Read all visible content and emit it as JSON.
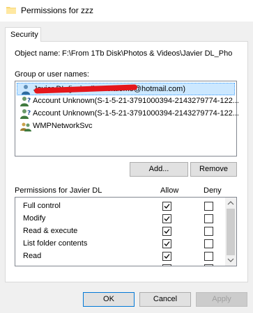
{
  "window": {
    "title": "Permissions for zzz",
    "icon": "folder-icon"
  },
  "tabs": [
    {
      "label": "Security",
      "active": true
    }
  ],
  "object": {
    "label": "Object name:",
    "value": "F:\\From 1Tb Disk\\Photos & Videos\\Javier DL_Pho"
  },
  "groups": {
    "label": "Group or user names:",
    "items": [
      {
        "text": "Javier DL (javierdiazdelalomo@hotmail.com)",
        "icon": "user-icon",
        "selected": true,
        "redacted": true
      },
      {
        "text": "Account Unknown(S-1-5-21-3791000394-2143279774-122...",
        "icon": "unknown-user-icon"
      },
      {
        "text": "Account Unknown(S-1-5-21-3791000394-2143279774-122...",
        "icon": "unknown-user-icon"
      },
      {
        "text": "WMPNetworkSvc",
        "icon": "group-icon"
      }
    ]
  },
  "buttons": {
    "add": "Add...",
    "remove": "Remove",
    "ok": "OK",
    "cancel": "Cancel",
    "apply": "Apply"
  },
  "permissions": {
    "label": "Permissions for Javier DL",
    "allow_label": "Allow",
    "deny_label": "Deny",
    "rows": [
      {
        "name": "Full control",
        "allow": true,
        "deny": false
      },
      {
        "name": "Modify",
        "allow": true,
        "deny": false
      },
      {
        "name": "Read & execute",
        "allow": true,
        "deny": false
      },
      {
        "name": "List folder contents",
        "allow": true,
        "deny": false
      },
      {
        "name": "Read",
        "allow": true,
        "deny": false
      },
      {
        "name": "",
        "allow": true,
        "deny": false
      }
    ]
  },
  "colors": {
    "selection": "#cce8ff",
    "accent": "#0078d7",
    "redaction": "#e5161b"
  }
}
